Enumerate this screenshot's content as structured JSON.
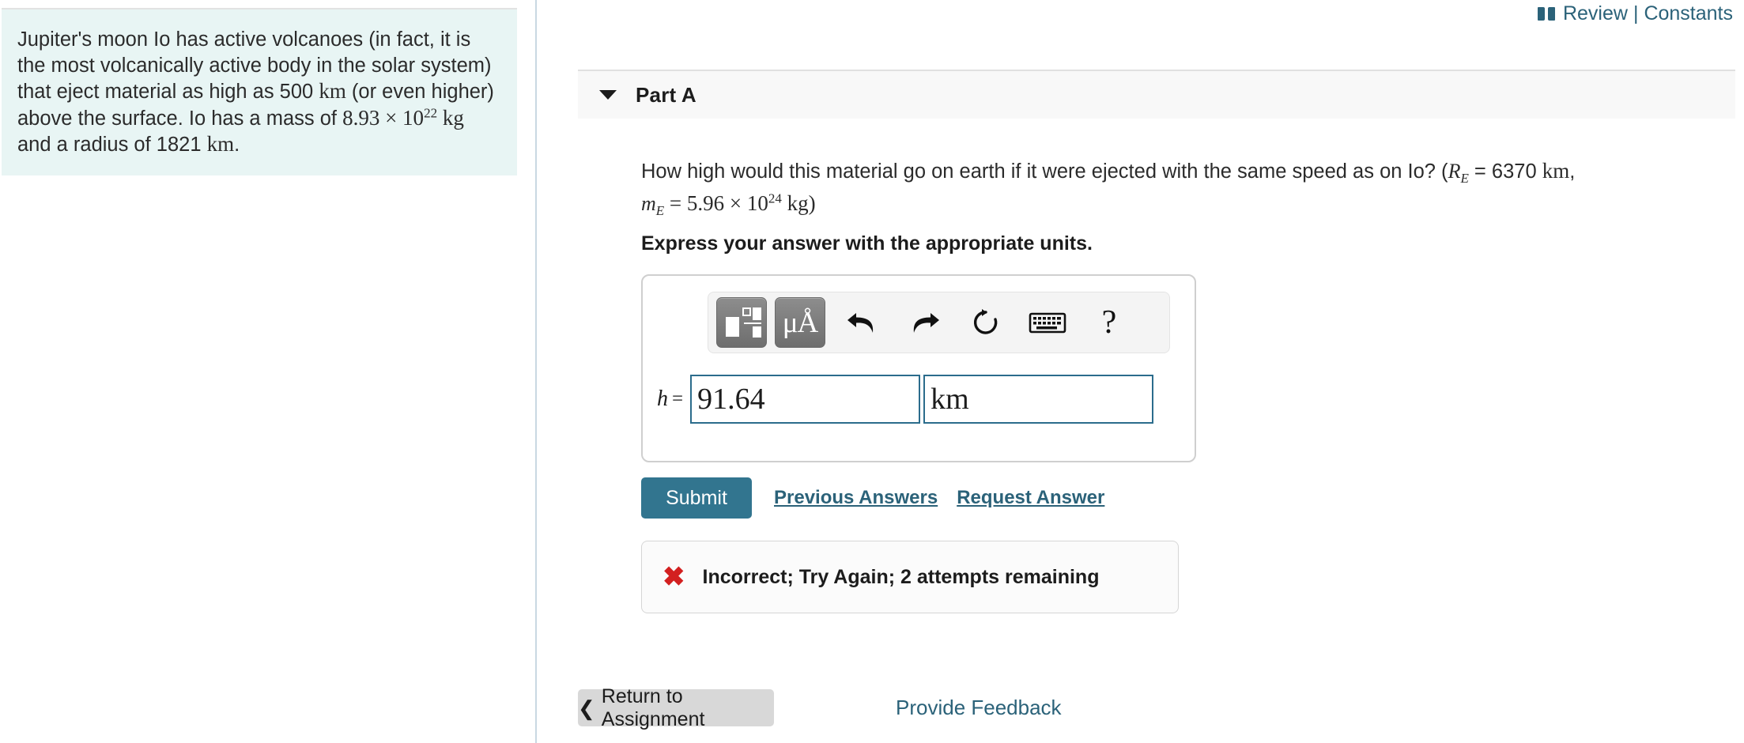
{
  "top_links": {
    "book_icon": "book-icon",
    "review_label": "Review",
    "separator": "|",
    "constants_label": "Constants"
  },
  "left_panel": {
    "text_plain": "Jupiter's moon Io has active volcanoes (in fact, it is the most volcanically active body in the solar system) that eject material as high as 500 km (or even higher) above the surface. Io has a mass of 8.93 × 10^22 kg and a radius of 1821 km.",
    "seg1": "Jupiter's moon Io has active volcanoes (in fact, it is the most volcanically active body in the solar system) that eject material as high as 500 ",
    "unit_km_1": "km",
    "seg2": " (or even higher) above the surface. Io has a mass of ",
    "mass_mantissa": "8.93 × 10",
    "mass_exponent": "22",
    "unit_kg": "kg",
    "seg3": " and a radius of 1821 ",
    "unit_km_2": "km",
    "seg4": "."
  },
  "part": {
    "caret_icon": "chevron-down-icon",
    "title": "Part A",
    "question": {
      "seg1": "How high would this material go on earth if it were ejected with the same speed as on Io? (",
      "re_symbol": "R",
      "re_sub": "E",
      "re_value": " = 6370 ",
      "re_unit": "km",
      "comma": ",",
      "me_symbol": "m",
      "me_sub": "E",
      "me_eq": " = 5.96 × 10",
      "me_exponent": "24",
      "me_unit": " kg)"
    },
    "instruction": "Express your answer with the appropriate units."
  },
  "answer": {
    "toolbar": {
      "template_button": "math-template-button",
      "units_button": "μÅ",
      "undo_button": "undo-icon",
      "redo_button": "redo-icon",
      "reset_button": "reset-icon",
      "keyboard_button": "keyboard-icon",
      "help_button": "?"
    },
    "variable_label": "h",
    "equals": "=",
    "value": "91.64",
    "value_placeholder": "",
    "units": "km",
    "units_placeholder": ""
  },
  "actions": {
    "submit_label": "Submit",
    "previous_answers_label": "Previous Answers",
    "request_answer_label": "Request Answer"
  },
  "feedback": {
    "status_icon": "✖",
    "status_color": "#d32020",
    "message": "Incorrect; Try Again; 2 attempts remaining"
  },
  "footer": {
    "return_chevron": "❮",
    "return_label": "Return to Assignment",
    "provide_feedback_label": "Provide Feedback"
  },
  "colors": {
    "accent": "#2b6279",
    "submit_button": "#32758f",
    "info_panel_bg": "#e8f5f4",
    "field_border": "#2b6c8c",
    "error": "#d32020"
  }
}
